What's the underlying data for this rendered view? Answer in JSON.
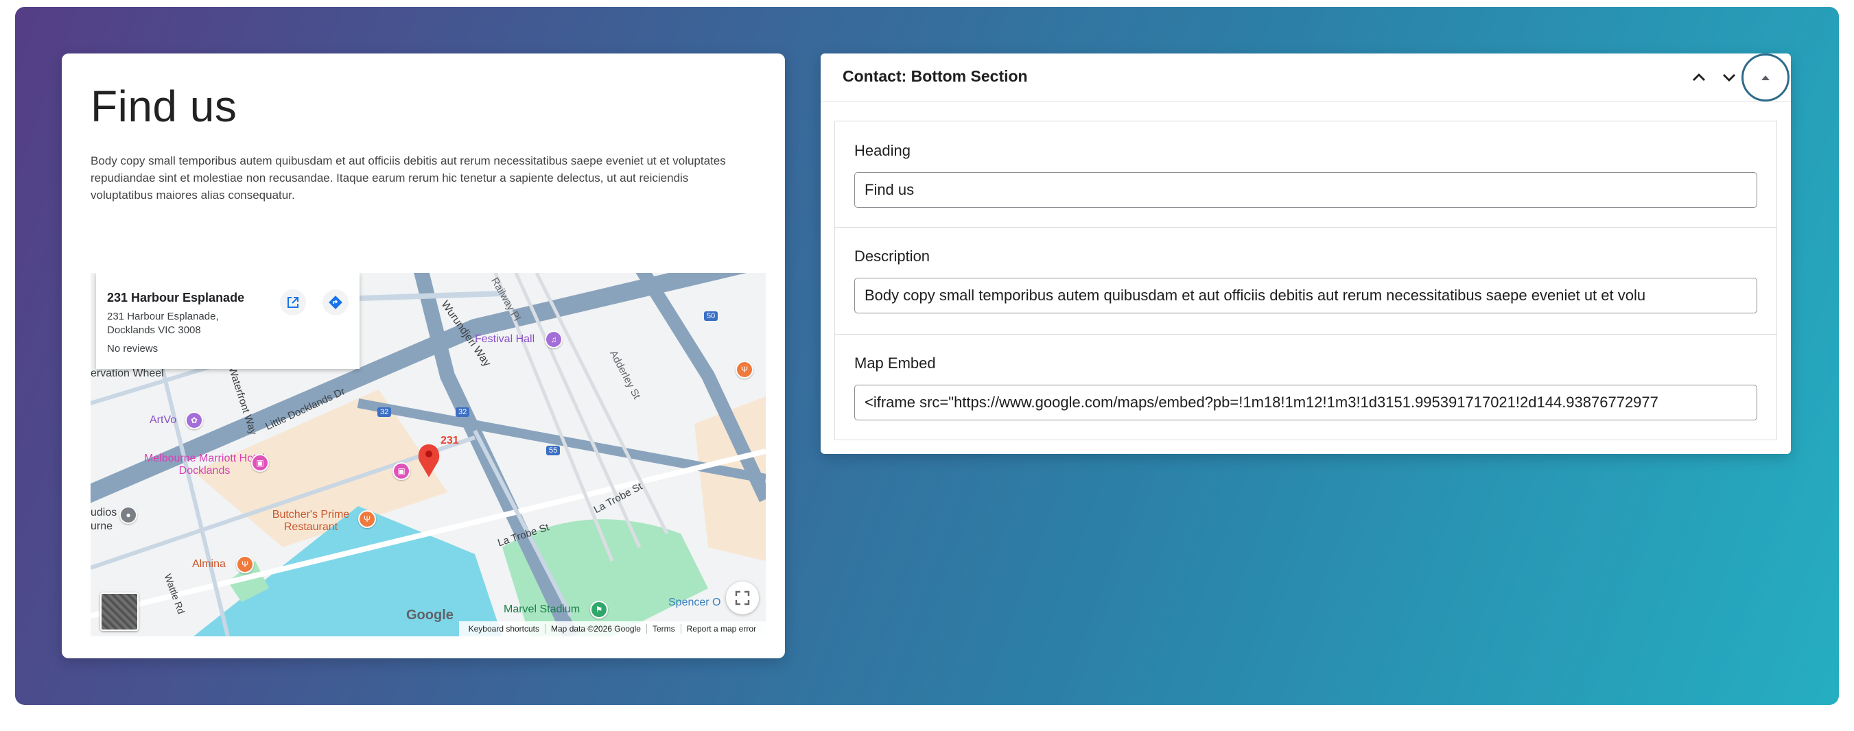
{
  "find_us": {
    "heading": "Find us",
    "body": "Body copy small temporibus autem quibusdam et aut officiis debitis aut rerum necessitatibus saepe eveniet ut et voluptates repudiandae sint et molestiae non recusandae. Itaque earum rerum hic tenetur a sapiente delectus, ut aut reiciendis voluptatibus maiores alias consequatur."
  },
  "map": {
    "place_title": "231 Harbour Esplanade",
    "place_address": "231 Harbour Esplanade, Docklands VIC 3008",
    "reviews": "No reviews",
    "marker_label": "231",
    "labels": {
      "railway": "Railway Pl",
      "wurundjeri": "Wurundjeri Way",
      "festival_hall": "Festival Hall",
      "adderley": "Adderley St",
      "observation_wheel": "ervation Wheel",
      "waterfront": "Waterfront Way",
      "little_docklands": "Little Docklands Dr",
      "artvo": "ArtVo",
      "marriott": "Melbourne Marriott Hotel Docklands",
      "studios": "udios\nurne",
      "butchers": "Butcher's Prime Restaurant",
      "la_trobe_1": "La Trobe St",
      "la_trobe_2": "La Trobe St",
      "almina": "Almina",
      "wattle": "Wattle Rd",
      "marvel": "Marvel Stadium",
      "spencer": "Spencer O",
      "shield_32a": "32",
      "shield_32b": "32",
      "shield_55": "55",
      "shield_50": "50"
    },
    "google": "Google",
    "footer": [
      "Keyboard shortcuts",
      "Map data ©2026 Google",
      "Terms",
      "Report a map error"
    ],
    "colors": {
      "water": "#7ed7e9",
      "park": "#a8e6c2",
      "roads": "#8aa3bd",
      "marker": "#ea4335"
    }
  },
  "panel": {
    "title": "Contact: Bottom Section",
    "fields": {
      "heading_label": "Heading",
      "heading_value": "Find us",
      "description_label": "Description",
      "description_value": "Body copy small temporibus autem quibusdam et aut officiis debitis aut rerum necessitatibus saepe eveniet ut et volu",
      "map_label": "Map Embed",
      "map_value": "<iframe src=\"https://www.google.com/maps/embed?pb=!1m18!1m12!1m3!1d3151.995391717021!2d144.93876772977"
    }
  },
  "icons": {
    "move_up": "chevron-up-icon",
    "move_down": "chevron-down-icon",
    "collapse": "triangle-up-icon",
    "open_external": "external-link-icon",
    "directions": "directions-icon",
    "fullscreen": "fullscreen-icon"
  }
}
